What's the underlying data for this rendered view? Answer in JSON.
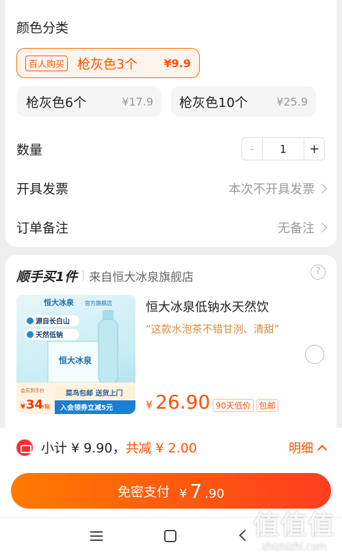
{
  "sku": {
    "section_title": "颜色分类",
    "options": [
      {
        "badge": "百人购买",
        "name": "枪灰色3个",
        "price": "¥9.9",
        "selected": true
      },
      {
        "name": "枪灰色6个",
        "price": "¥17.9",
        "selected": false
      },
      {
        "name": "枪灰色10个",
        "price": "¥25.9",
        "selected": false
      }
    ]
  },
  "quantity": {
    "label": "数量",
    "value": "1",
    "minus": "-",
    "plus": "+"
  },
  "invoice": {
    "label": "开具发票",
    "value": "本次不开具发票"
  },
  "note": {
    "label": "订单备注",
    "value": "无备注"
  },
  "bundle": {
    "title": "顺手买1件",
    "from": "来自恒大冰泉旗舰店",
    "help": "?",
    "product": {
      "name": "恒大冰泉低钠水天然饮",
      "quote": "“这款水泡茶不错甘洌、清甜”",
      "price_symbol": "¥",
      "price": "26.90",
      "tags": [
        "90天低价",
        "包邮"
      ],
      "image": {
        "brand": "恒大冰泉",
        "store": "官方旗舰店",
        "chip1": "源自长白山",
        "chip2": "天然低钠",
        "promo_price": "34",
        "promo_top": "会员到手价",
        "promo_unit": "/箱",
        "ship_text": "菜鸟包邮 送货上门",
        "coupon_text": "入会领券立减5元"
      }
    }
  },
  "summary": {
    "subtotal": "小计 ¥ 9.90，",
    "discount": "共减 ¥ 2.00",
    "detail": "明细"
  },
  "pay": {
    "label": "免密支付",
    "currency": "¥",
    "amount_int": "7",
    "amount_dec": ".90"
  },
  "watermark": {
    "big": "值值值",
    "small": "zhizhizhi.com"
  },
  "colors": {
    "accent": "#ff5000",
    "gradient_start": "#ff7a00",
    "gradient_end": "#ff3d1e"
  }
}
